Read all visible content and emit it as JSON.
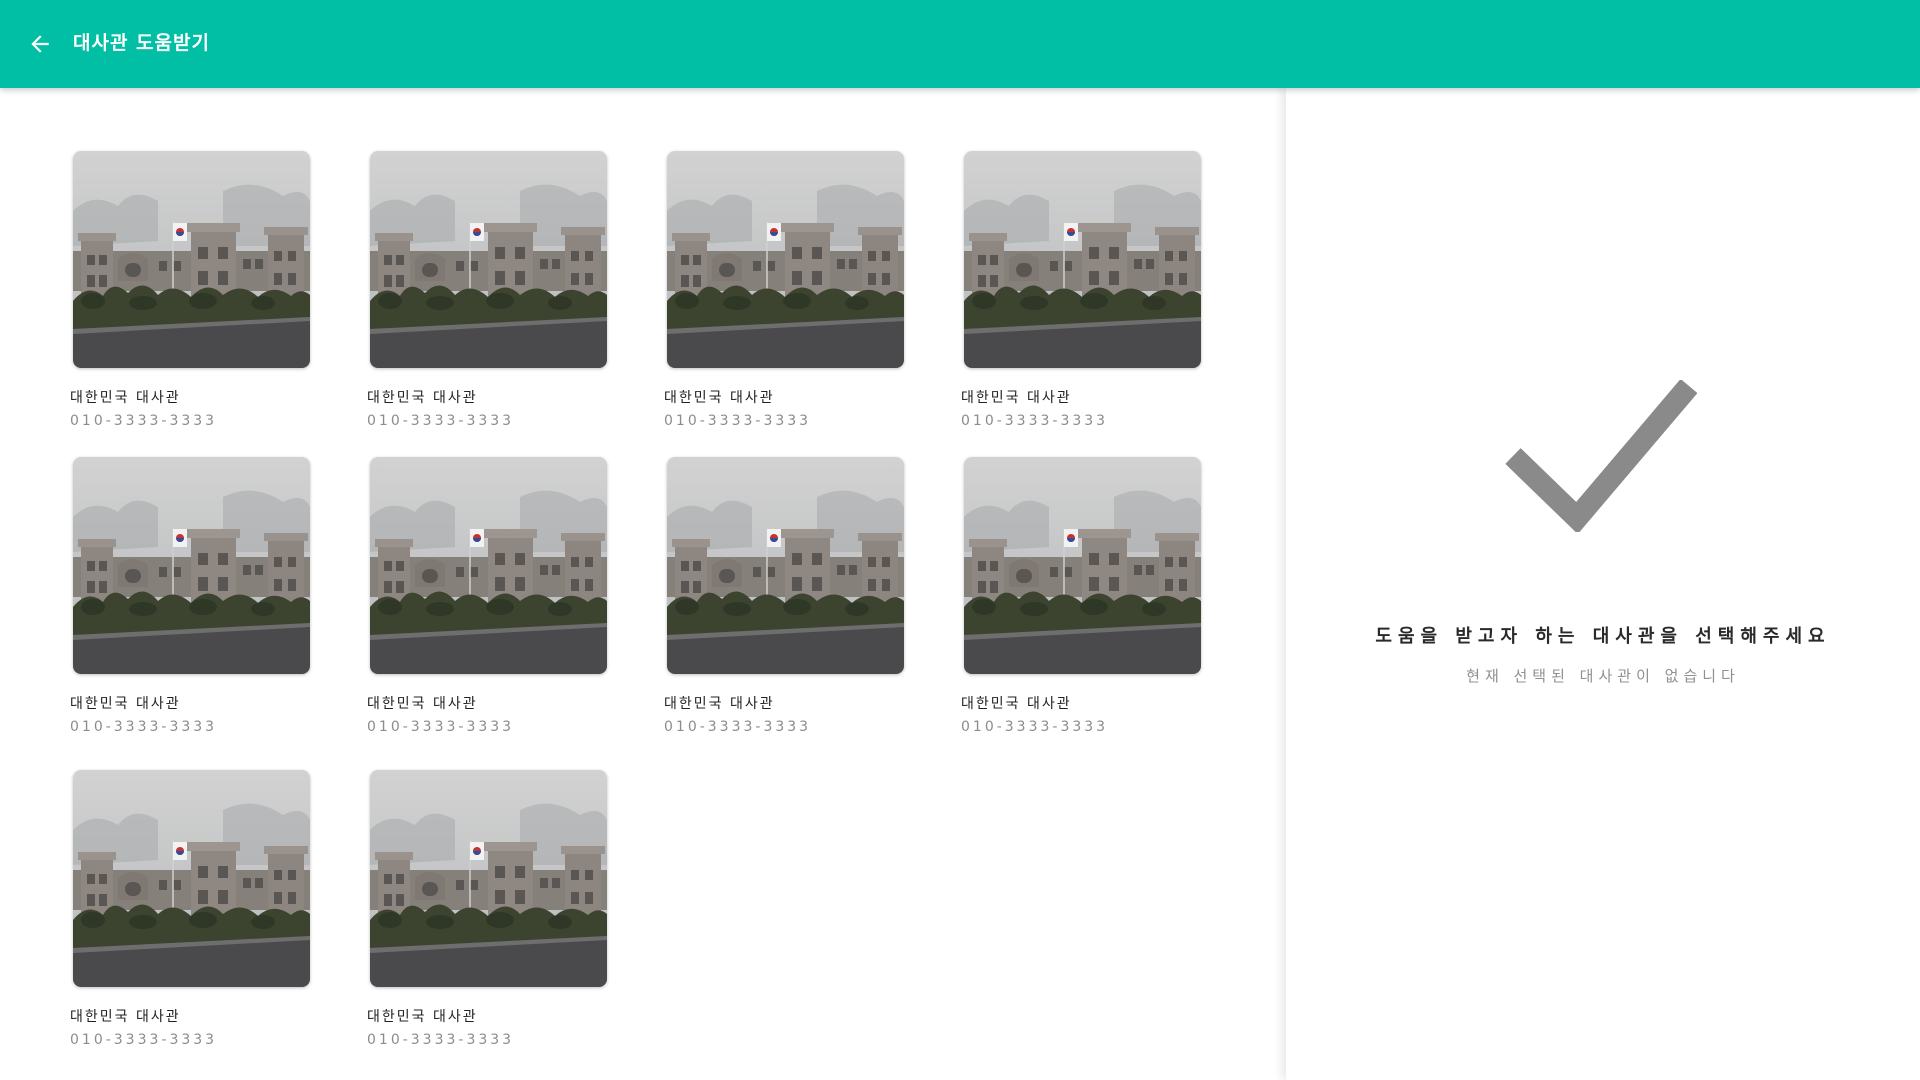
{
  "app_bar": {
    "title": "대사관 도움받기",
    "back_icon": "arrow-left-icon",
    "background_color": "#00bfa5"
  },
  "embassies": [
    {
      "name": "대한민국 대사관",
      "phone": "010-3333-3333",
      "photo": "embassy-building-photo"
    },
    {
      "name": "대한민국 대사관",
      "phone": "010-3333-3333",
      "photo": "embassy-building-photo"
    },
    {
      "name": "대한민국 대사관",
      "phone": "010-3333-3333",
      "photo": "embassy-building-photo"
    },
    {
      "name": "대한민국 대사관",
      "phone": "010-3333-3333",
      "photo": "embassy-building-photo"
    },
    {
      "name": "대한민국 대사관",
      "phone": "010-3333-3333",
      "photo": "embassy-building-photo"
    },
    {
      "name": "대한민국 대사관",
      "phone": "010-3333-3333",
      "photo": "embassy-building-photo"
    },
    {
      "name": "대한민국 대사관",
      "phone": "010-3333-3333",
      "photo": "embassy-building-photo"
    },
    {
      "name": "대한민국 대사관",
      "phone": "010-3333-3333",
      "photo": "embassy-building-photo"
    },
    {
      "name": "대한민국 대사관",
      "phone": "010-3333-3333",
      "photo": "embassy-building-photo"
    },
    {
      "name": "대한민국 대사관",
      "phone": "010-3333-3333",
      "photo": "embassy-building-photo"
    }
  ],
  "detail_panel": {
    "icon": "checkmark-icon",
    "icon_color": "#8a8a8a",
    "title": "도움을 받고자 하는 대사관을 선택해주세요",
    "subtitle": "현재 선택된 대사관이 없습니다"
  }
}
